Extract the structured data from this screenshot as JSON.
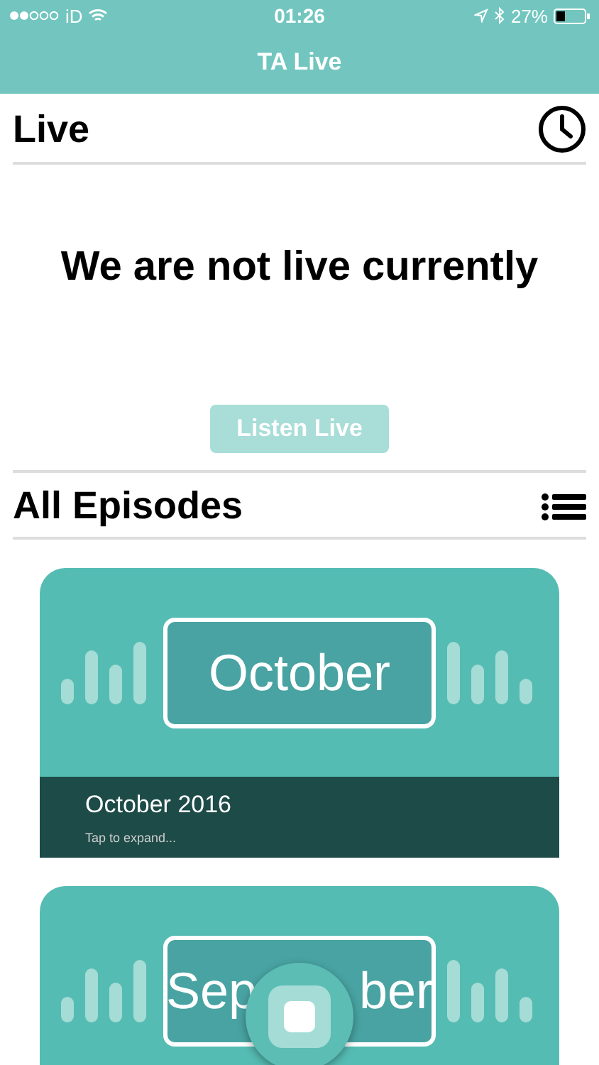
{
  "status_bar": {
    "carrier": "iD",
    "time": "01:26",
    "battery": "27%"
  },
  "nav": {
    "title": "TA Live"
  },
  "live": {
    "title": "Live",
    "message": "We are not live currently",
    "button": {
      "label": "Listen Live",
      "disabled": true
    }
  },
  "episodes": {
    "title": "All Episodes",
    "items": [
      {
        "badge_parts": [
          "October"
        ],
        "title": "October 2016",
        "hint": "Tap to expand..."
      },
      {
        "badge_parts": [
          "Sep",
          "ber"
        ]
      }
    ]
  }
}
